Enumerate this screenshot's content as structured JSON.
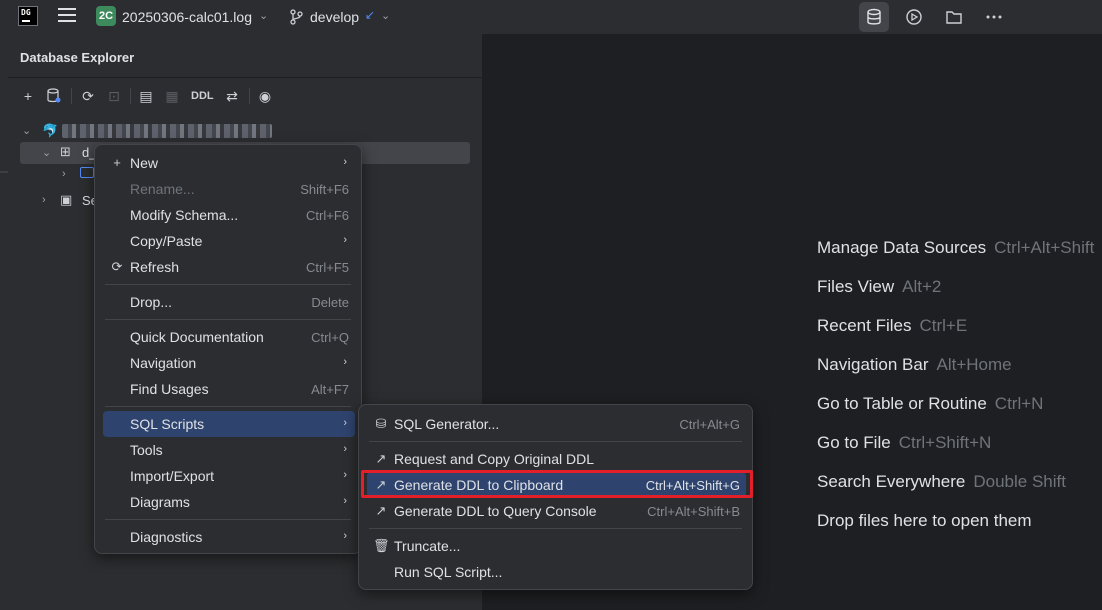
{
  "titlebar": {
    "app_logo": "DG",
    "menu_icon": "hamburger-menu-icon",
    "file_badge": "2C",
    "file_name": "20250306-calc01.log",
    "branch_name": "develop",
    "right_icons": [
      "database-icon",
      "run-icon",
      "folder-icon",
      "more-icon"
    ]
  },
  "panel": {
    "title": "Database Explorer",
    "toolbar": {
      "ddl_label": "DDL",
      "icons": [
        "add-icon",
        "data-source-properties-icon",
        "refresh-icon",
        "disconnect-icon",
        "console-icon",
        "table-icon",
        "ddl-icon",
        "jump-to-icon",
        "view-options-icon"
      ]
    },
    "tree": {
      "schema_prefix": "d_",
      "server_prefix": "Se"
    }
  },
  "context_menu": {
    "items": [
      {
        "label": "New",
        "key": "",
        "submenu": true,
        "icon": "plus-icon"
      },
      {
        "label": "Rename...",
        "key": "Shift+F6",
        "disabled": true
      },
      {
        "label": "Modify Schema...",
        "key": "Ctrl+F6"
      },
      {
        "label": "Copy/Paste",
        "key": "",
        "submenu": true
      },
      {
        "label": "Refresh",
        "key": "Ctrl+F5",
        "icon": "refresh-icon"
      },
      {
        "label": "Drop...",
        "key": "Delete"
      },
      {
        "label": "Quick Documentation",
        "key": "Ctrl+Q"
      },
      {
        "label": "Navigation",
        "key": "",
        "submenu": true
      },
      {
        "label": "Find Usages",
        "key": "Alt+F7"
      },
      {
        "label": "SQL Scripts",
        "key": "",
        "submenu": true,
        "selected": true
      },
      {
        "label": "Tools",
        "key": "",
        "submenu": true
      },
      {
        "label": "Import/Export",
        "key": "",
        "submenu": true
      },
      {
        "label": "Diagrams",
        "key": "",
        "submenu": true
      },
      {
        "label": "Diagnostics",
        "key": "",
        "submenu": true
      }
    ]
  },
  "submenu": {
    "items": [
      {
        "label": "SQL Generator...",
        "key": "Ctrl+Alt+G",
        "icon": "sql-generator-icon"
      },
      {
        "label": "Request and Copy Original DDL",
        "key": "",
        "icon": "external-link-icon"
      },
      {
        "label": "Generate DDL to Clipboard",
        "key": "Ctrl+Alt+Shift+G",
        "icon": "external-link-icon",
        "selected": true
      },
      {
        "label": "Generate DDL to Query Console",
        "key": "Ctrl+Alt+Shift+B",
        "icon": "external-link-icon"
      },
      {
        "label": "Truncate...",
        "key": "",
        "icon": "trash-icon"
      },
      {
        "label": "Run SQL Script...",
        "key": ""
      }
    ]
  },
  "editor_hints": [
    {
      "label": "Manage Data Sources",
      "key": "Ctrl+Alt+Shift"
    },
    {
      "label": "Files View",
      "key": "Alt+2"
    },
    {
      "label": "Recent Files",
      "key": "Ctrl+E"
    },
    {
      "label": "Navigation Bar",
      "key": "Alt+Home"
    },
    {
      "label": "Go to Table or Routine",
      "key": "Ctrl+N"
    },
    {
      "label": "Go to File",
      "key": "Ctrl+Shift+N"
    },
    {
      "label": "Search Everywhere",
      "key": "Double Shift"
    },
    {
      "label": "Drop files here to open them",
      "key": ""
    }
  ],
  "colors": {
    "background": "#1e1f22",
    "panel": "#2b2d30",
    "selection": "#2e436e",
    "highlight_box": "#e3202a"
  }
}
